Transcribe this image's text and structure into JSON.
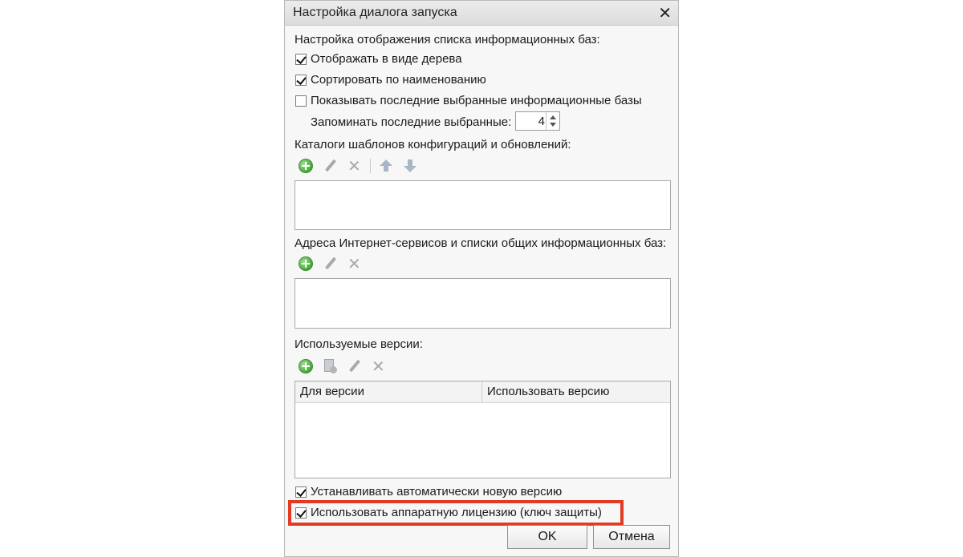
{
  "dialog": {
    "title": "Настройка диалога запуска",
    "close_glyph": "✕"
  },
  "display_settings": {
    "heading": "Настройка отображения списка информационных баз:",
    "tree_view": {
      "label": "Отображать в виде дерева",
      "checked": true
    },
    "sort_by_name": {
      "label": "Сортировать по наименованию",
      "checked": true
    },
    "show_recent": {
      "label": "Показывать последние выбранные информационные базы",
      "checked": false
    },
    "remember_recent": {
      "label": "Запоминать последние выбранные:",
      "value": "4"
    }
  },
  "templates": {
    "heading": "Каталоги шаблонов конфигураций и обновлений:",
    "toolbar_icons": [
      "add-icon",
      "edit-icon",
      "delete-icon",
      "move-up-icon",
      "move-down-icon"
    ]
  },
  "internet_services": {
    "heading": "Адреса Интернет-сервисов и списки общих информационных баз:",
    "toolbar_icons": [
      "add-icon",
      "edit-icon",
      "delete-icon"
    ]
  },
  "versions": {
    "heading": "Используемые версии:",
    "toolbar_icons": [
      "add-icon",
      "copy-icon",
      "edit-icon",
      "delete-icon"
    ],
    "columns": [
      "Для версии",
      "Использовать версию"
    ]
  },
  "auto_install": {
    "label": "Устанавливать автоматически новую версию",
    "checked": true
  },
  "hardware_license": {
    "label": "Использовать аппаратную лицензию (ключ защиты)",
    "checked": true
  },
  "buttons": {
    "ok": "OK",
    "cancel": "Отмена"
  },
  "colors": {
    "highlight": "#e23b24",
    "add_icon": "#45a83a"
  }
}
